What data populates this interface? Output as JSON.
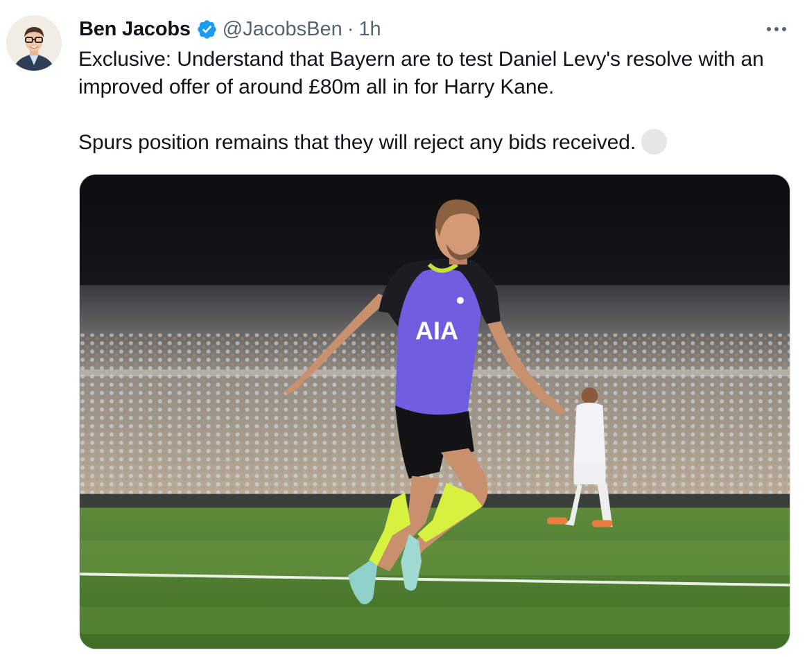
{
  "tweet": {
    "author_name": "Ben Jacobs",
    "handle": "@JacobsBen",
    "separator": "·",
    "time": "1h",
    "text_line1": "Exclusive: Understand that Bayern are to test Daniel Levy's resolve with an improved offer of around £80m all in for Harry Kane.",
    "text_line2": "Spurs position remains that they will reject any bids received."
  },
  "media": {
    "jersey_sponsor": "AIA"
  },
  "colors": {
    "verified_blue": "#1d9bf0",
    "secondary_text": "#536471",
    "primary_text": "#0f1419"
  },
  "icons": {
    "verified": "verified-badge-icon",
    "more": "more-horizontal-icon"
  }
}
